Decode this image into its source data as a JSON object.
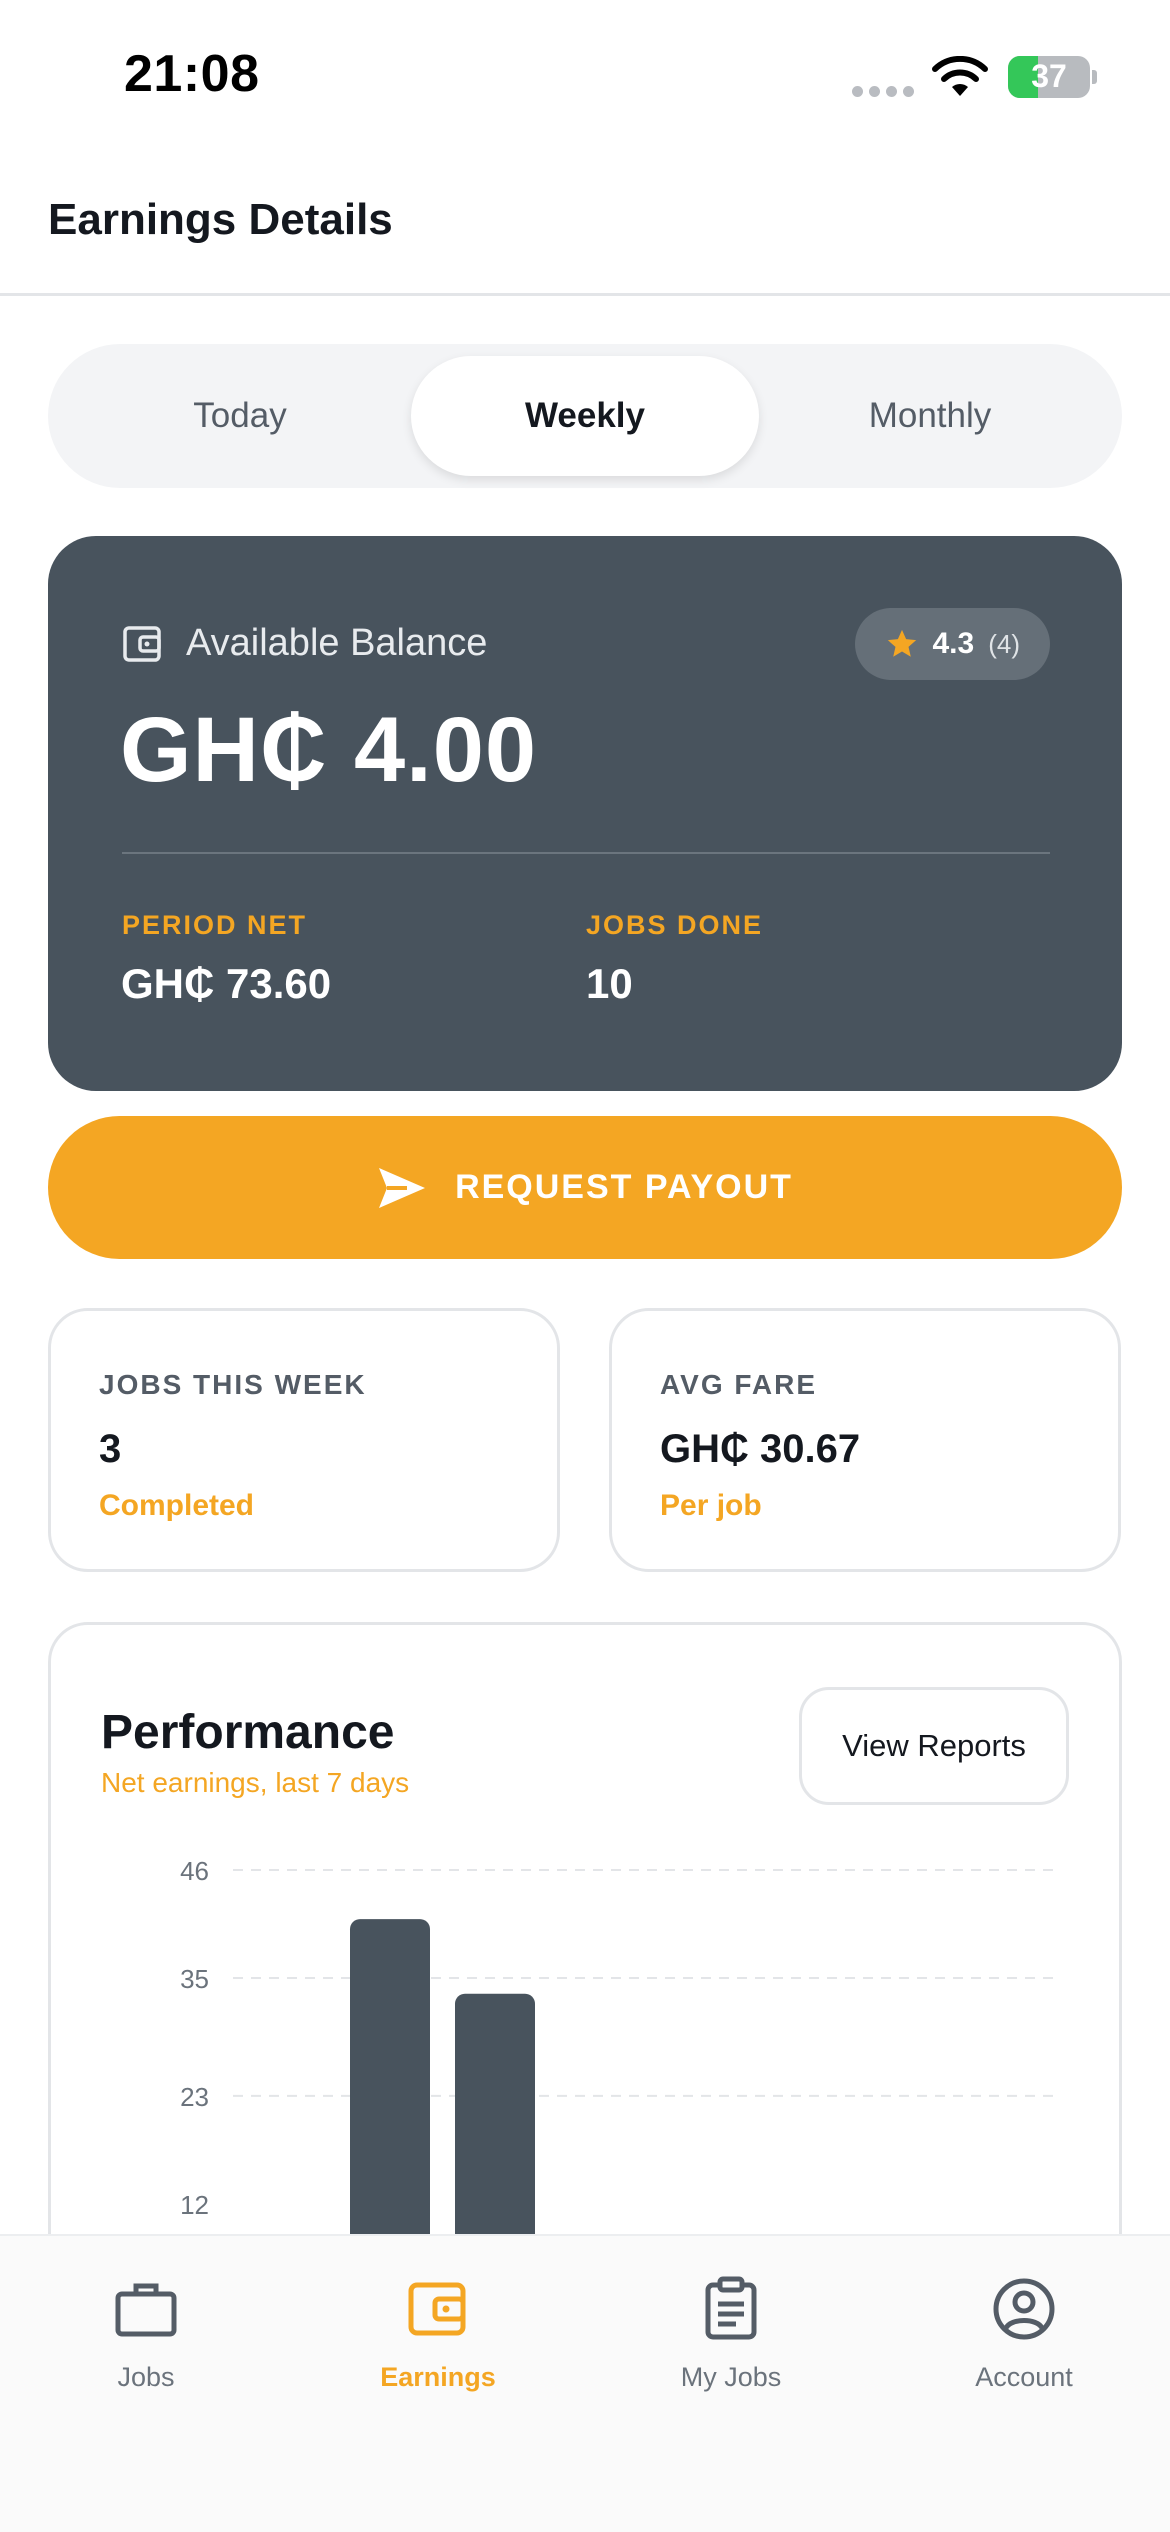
{
  "status_bar": {
    "time": "21:08",
    "battery": "37",
    "battery_level": 0.37
  },
  "header": {
    "title": "Earnings Details"
  },
  "period_tabs": [
    {
      "label": "Today",
      "active": false
    },
    {
      "label": "Weekly",
      "active": true
    },
    {
      "label": "Monthly",
      "active": false
    }
  ],
  "balance_card": {
    "label": "Available Balance",
    "amount": "GH₵ 4.00",
    "rating": {
      "value": "4.3",
      "count": "(4)"
    },
    "period_net": {
      "label": "PERIOD NET",
      "value": "GH₵ 73.60"
    },
    "jobs_done": {
      "label": "JOBS DONE",
      "value": "10"
    }
  },
  "payout_button": {
    "label": "REQUEST PAYOUT"
  },
  "stats": [
    {
      "label": "JOBS THIS WEEK",
      "value": "3",
      "sub": "Completed"
    },
    {
      "label": "AVG FARE",
      "value": "GH₵ 30.67",
      "sub": "Per job"
    }
  ],
  "performance": {
    "title": "Performance",
    "subtitle": "Net earnings, last 7 days",
    "button_label": "View Reports"
  },
  "chart_data": {
    "type": "bar",
    "ytick_labels": [
      "46",
      "35",
      "23",
      "12"
    ],
    "yticks": [
      46,
      35,
      23,
      12
    ],
    "ylim": [
      0,
      46
    ],
    "values": [
      41,
      33.4,
      null,
      null,
      null,
      null,
      null
    ],
    "grid": true,
    "colors": {
      "bar": "#48535d",
      "grid": "#e3e5e8"
    }
  },
  "bottom_nav": [
    {
      "label": "Jobs",
      "icon": "briefcase-icon",
      "active": false
    },
    {
      "label": "Earnings",
      "icon": "wallet-icon",
      "active": true
    },
    {
      "label": "My Jobs",
      "icon": "clipboard-icon",
      "active": false
    },
    {
      "label": "Account",
      "icon": "user-circle-icon",
      "active": false
    }
  ],
  "colors": {
    "accent": "#f4a623",
    "card_dark": "#48535d",
    "text_dark": "#14181f",
    "text_muted": "#545c66"
  }
}
